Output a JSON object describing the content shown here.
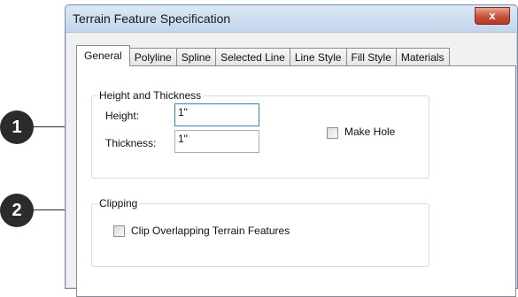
{
  "window": {
    "title": "Terrain Feature Specification",
    "close_glyph": "x"
  },
  "tabs": [
    {
      "label": "General",
      "active": true
    },
    {
      "label": "Polyline"
    },
    {
      "label": "Spline"
    },
    {
      "label": "Selected Line"
    },
    {
      "label": "Line Style"
    },
    {
      "label": "Fill Style"
    },
    {
      "label": "Materials"
    }
  ],
  "height_thickness": {
    "title": "Height and Thickness",
    "height_label": "Height:",
    "height_value": "1\"",
    "thickness_label": "Thickness:",
    "thickness_value": "1\"",
    "make_hole_label": "Make Hole",
    "make_hole_checked": false
  },
  "clipping": {
    "title": "Clipping",
    "clip_label": "Clip Overlapping Terrain Features",
    "clip_checked": false
  },
  "callouts": [
    "1",
    "2"
  ]
}
